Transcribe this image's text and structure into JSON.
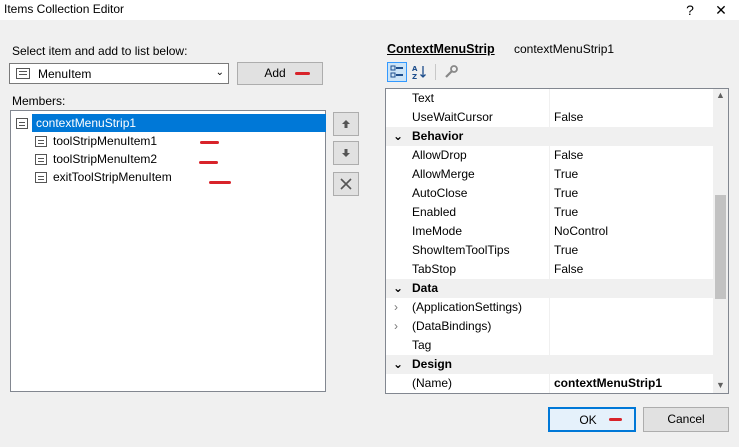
{
  "window": {
    "title": "Items Collection Editor",
    "help_glyph": "?",
    "close_glyph": "✕"
  },
  "left": {
    "select_label": "Select item and add to list below:",
    "combo_value": "MenuItem",
    "add_label": "Add",
    "members_label": "Members:",
    "members": [
      {
        "label": "contextMenuStrip1",
        "level": 0,
        "selected": true
      },
      {
        "label": "toolStripMenuItem1",
        "level": 1,
        "selected": false
      },
      {
        "label": "toolStripMenuItem2",
        "level": 1,
        "selected": false
      },
      {
        "label": "exitToolStripMenuItem",
        "level": 1,
        "selected": false
      }
    ]
  },
  "right": {
    "object_type": "ContextMenuStrip",
    "object_name": "contextMenuStrip1",
    "rows": [
      {
        "kind": "prop",
        "name": "Text",
        "value": ""
      },
      {
        "kind": "prop",
        "name": "UseWaitCursor",
        "value": "False"
      },
      {
        "kind": "cat",
        "name": "Behavior"
      },
      {
        "kind": "prop",
        "name": "AllowDrop",
        "value": "False"
      },
      {
        "kind": "prop",
        "name": "AllowMerge",
        "value": "True"
      },
      {
        "kind": "prop",
        "name": "AutoClose",
        "value": "True"
      },
      {
        "kind": "prop",
        "name": "Enabled",
        "value": "True"
      },
      {
        "kind": "prop",
        "name": "ImeMode",
        "value": "NoControl"
      },
      {
        "kind": "prop",
        "name": "ShowItemToolTips",
        "value": "True"
      },
      {
        "kind": "prop",
        "name": "TabStop",
        "value": "False"
      },
      {
        "kind": "cat",
        "name": "Data"
      },
      {
        "kind": "prop",
        "name": "(ApplicationSettings)",
        "value": "",
        "expandable": true
      },
      {
        "kind": "prop",
        "name": "(DataBindings)",
        "value": "",
        "expandable": true
      },
      {
        "kind": "prop",
        "name": "Tag",
        "value": ""
      },
      {
        "kind": "cat",
        "name": "Design"
      },
      {
        "kind": "prop",
        "name": "(Name)",
        "value": "contextMenuStrip1",
        "bold": true
      }
    ]
  },
  "buttons": {
    "ok": "OK",
    "cancel": "Cancel"
  }
}
